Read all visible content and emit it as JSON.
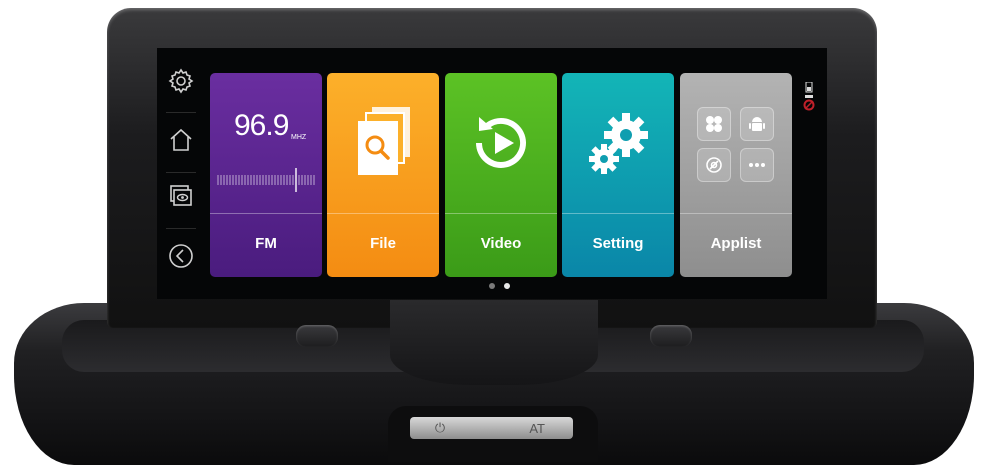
{
  "device": {
    "power_label": "⏻",
    "at_label": "AT"
  },
  "nav": {
    "items": [
      {
        "icon": "gear-icon"
      },
      {
        "icon": "home-icon"
      },
      {
        "icon": "screen-mirror-icon"
      },
      {
        "icon": "back-icon"
      }
    ]
  },
  "tiles": {
    "fm": {
      "label": "FM",
      "frequency": "96.9",
      "unit": "MHZ",
      "color": "#5a258f"
    },
    "file": {
      "label": "File",
      "color": "#f8a01e"
    },
    "video": {
      "label": "Video",
      "color": "#4cb01e"
    },
    "setting": {
      "label": "Setting",
      "color": "#0f9eb0"
    },
    "applist": {
      "label": "Applist",
      "color": "#a5a5a5"
    }
  },
  "pager": {
    "pages": 2,
    "active": 2
  },
  "status": {
    "icons": [
      "battery-icon",
      "gps-icon"
    ]
  }
}
